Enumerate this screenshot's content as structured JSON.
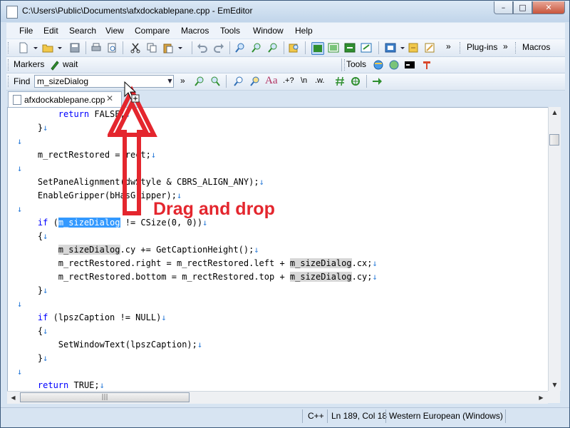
{
  "window": {
    "title": "C:\\Users\\Public\\Documents\\afxdockablepane.cpp - EmEditor",
    "min": "–",
    "max": "□",
    "close": "✕"
  },
  "menubar": {
    "items": [
      {
        "label": "File"
      },
      {
        "label": "Edit"
      },
      {
        "label": "Search"
      },
      {
        "label": "View"
      },
      {
        "label": "Compare"
      },
      {
        "label": "Macros"
      },
      {
        "label": "Tools"
      },
      {
        "label": "Window"
      },
      {
        "label": "Help"
      }
    ]
  },
  "toolbars": {
    "plugins_label": "Plug-ins",
    "macros_label": "Macros",
    "markers_label": "Markers",
    "markers_value": "wait",
    "tools_label": "Tools",
    "chevron": "»"
  },
  "find": {
    "label": "Find",
    "value": "m_sizeDialog",
    "regex_label": ".+?",
    "newline_label": "\\n",
    "word_label": ".w.",
    "case_label": "Aa",
    "chevron": "»"
  },
  "tab": {
    "filename": "afxdockablepane.cpp",
    "close": "✕"
  },
  "editor": {
    "lines": [
      {
        "id": "l0",
        "indent": "        ",
        "parts": [
          {
            "t": "return",
            "c": "kw"
          },
          {
            "t": " FALSE;",
            "c": ""
          },
          {
            "t": "↓",
            "c": "ret"
          }
        ]
      },
      {
        "id": "l1",
        "indent": "    ",
        "parts": [
          {
            "t": "}",
            "c": ""
          },
          {
            "t": "↓",
            "c": "ret"
          }
        ]
      },
      {
        "id": "l2",
        "indent": "",
        "parts": [
          {
            "t": "↓",
            "c": "ret"
          }
        ]
      },
      {
        "id": "l3",
        "indent": "    ",
        "parts": [
          {
            "t": "m_rectRestored = rect;",
            "c": ""
          },
          {
            "t": "↓",
            "c": "ret"
          }
        ]
      },
      {
        "id": "l4",
        "indent": "",
        "parts": [
          {
            "t": "↓",
            "c": "ret"
          }
        ]
      },
      {
        "id": "l5",
        "indent": "    ",
        "parts": [
          {
            "t": "SetPaneAlignment(dwStyle & CBRS_ALIGN_ANY);",
            "c": ""
          },
          {
            "t": "↓",
            "c": "ret"
          }
        ]
      },
      {
        "id": "l6",
        "indent": "    ",
        "parts": [
          {
            "t": "EnableGripper(bHasGripper);",
            "c": ""
          },
          {
            "t": "↓",
            "c": "ret"
          }
        ]
      },
      {
        "id": "l7",
        "indent": "",
        "parts": [
          {
            "t": "↓",
            "c": "ret"
          }
        ]
      },
      {
        "id": "l8",
        "indent": "    ",
        "parts": [
          {
            "t": "if",
            "c": "kw"
          },
          {
            "t": " (",
            "c": ""
          },
          {
            "t": "m_sizeDialog",
            "c": "hl"
          },
          {
            "t": " != CSize(0, 0))",
            "c": ""
          },
          {
            "t": "↓",
            "c": "ret"
          }
        ]
      },
      {
        "id": "l9",
        "indent": "    ",
        "parts": [
          {
            "t": "{",
            "c": ""
          },
          {
            "t": "↓",
            "c": "ret"
          }
        ]
      },
      {
        "id": "l10",
        "indent": "        ",
        "parts": [
          {
            "t": "m_sizeDialog",
            "c": "hl2"
          },
          {
            "t": ".cy += GetCaptionHeight();",
            "c": ""
          },
          {
            "t": "↓",
            "c": "ret"
          }
        ]
      },
      {
        "id": "l11",
        "indent": "        ",
        "parts": [
          {
            "t": "m_rectRestored.right = m_rectRestored.left + ",
            "c": ""
          },
          {
            "t": "m_sizeDialog",
            "c": "hl2"
          },
          {
            "t": ".cx;",
            "c": ""
          },
          {
            "t": "↓",
            "c": "ret"
          }
        ]
      },
      {
        "id": "l12",
        "indent": "        ",
        "parts": [
          {
            "t": "m_rectRestored.bottom = m_rectRestored.top + ",
            "c": ""
          },
          {
            "t": "m_sizeDialog",
            "c": "hl2"
          },
          {
            "t": ".cy;",
            "c": ""
          },
          {
            "t": "↓",
            "c": "ret"
          }
        ]
      },
      {
        "id": "l13",
        "indent": "    ",
        "parts": [
          {
            "t": "}",
            "c": ""
          },
          {
            "t": "↓",
            "c": "ret"
          }
        ]
      },
      {
        "id": "l14",
        "indent": "",
        "parts": [
          {
            "t": "↓",
            "c": "ret"
          }
        ]
      },
      {
        "id": "l15",
        "indent": "    ",
        "parts": [
          {
            "t": "if",
            "c": "kw"
          },
          {
            "t": " (lpszCaption != NULL)",
            "c": ""
          },
          {
            "t": "↓",
            "c": "ret"
          }
        ]
      },
      {
        "id": "l16",
        "indent": "    ",
        "parts": [
          {
            "t": "{",
            "c": ""
          },
          {
            "t": "↓",
            "c": "ret"
          }
        ]
      },
      {
        "id": "l17",
        "indent": "        ",
        "parts": [
          {
            "t": "SetWindowText(lpszCaption);",
            "c": ""
          },
          {
            "t": "↓",
            "c": "ret"
          }
        ]
      },
      {
        "id": "l18",
        "indent": "    ",
        "parts": [
          {
            "t": "}",
            "c": ""
          },
          {
            "t": "↓",
            "c": "ret"
          }
        ]
      },
      {
        "id": "l19",
        "indent": "",
        "parts": [
          {
            "t": "↓",
            "c": "ret"
          }
        ]
      },
      {
        "id": "l20",
        "indent": "    ",
        "parts": [
          {
            "t": "return",
            "c": "kw"
          },
          {
            "t": " TRUE;",
            "c": ""
          },
          {
            "t": "↓",
            "c": "ret"
          }
        ]
      }
    ]
  },
  "overlay": {
    "text": "Drag and drop"
  },
  "statusbar": {
    "language": "C++",
    "position": "Ln 189, Col 18",
    "encoding": "Western European (Windows)"
  },
  "colors": {
    "keyword": "#0000ff",
    "return_mark": "#2a7bd8",
    "selection": "#3399ff",
    "match_highlight": "#d7d7d7",
    "overlay_red": "#e4262e"
  }
}
